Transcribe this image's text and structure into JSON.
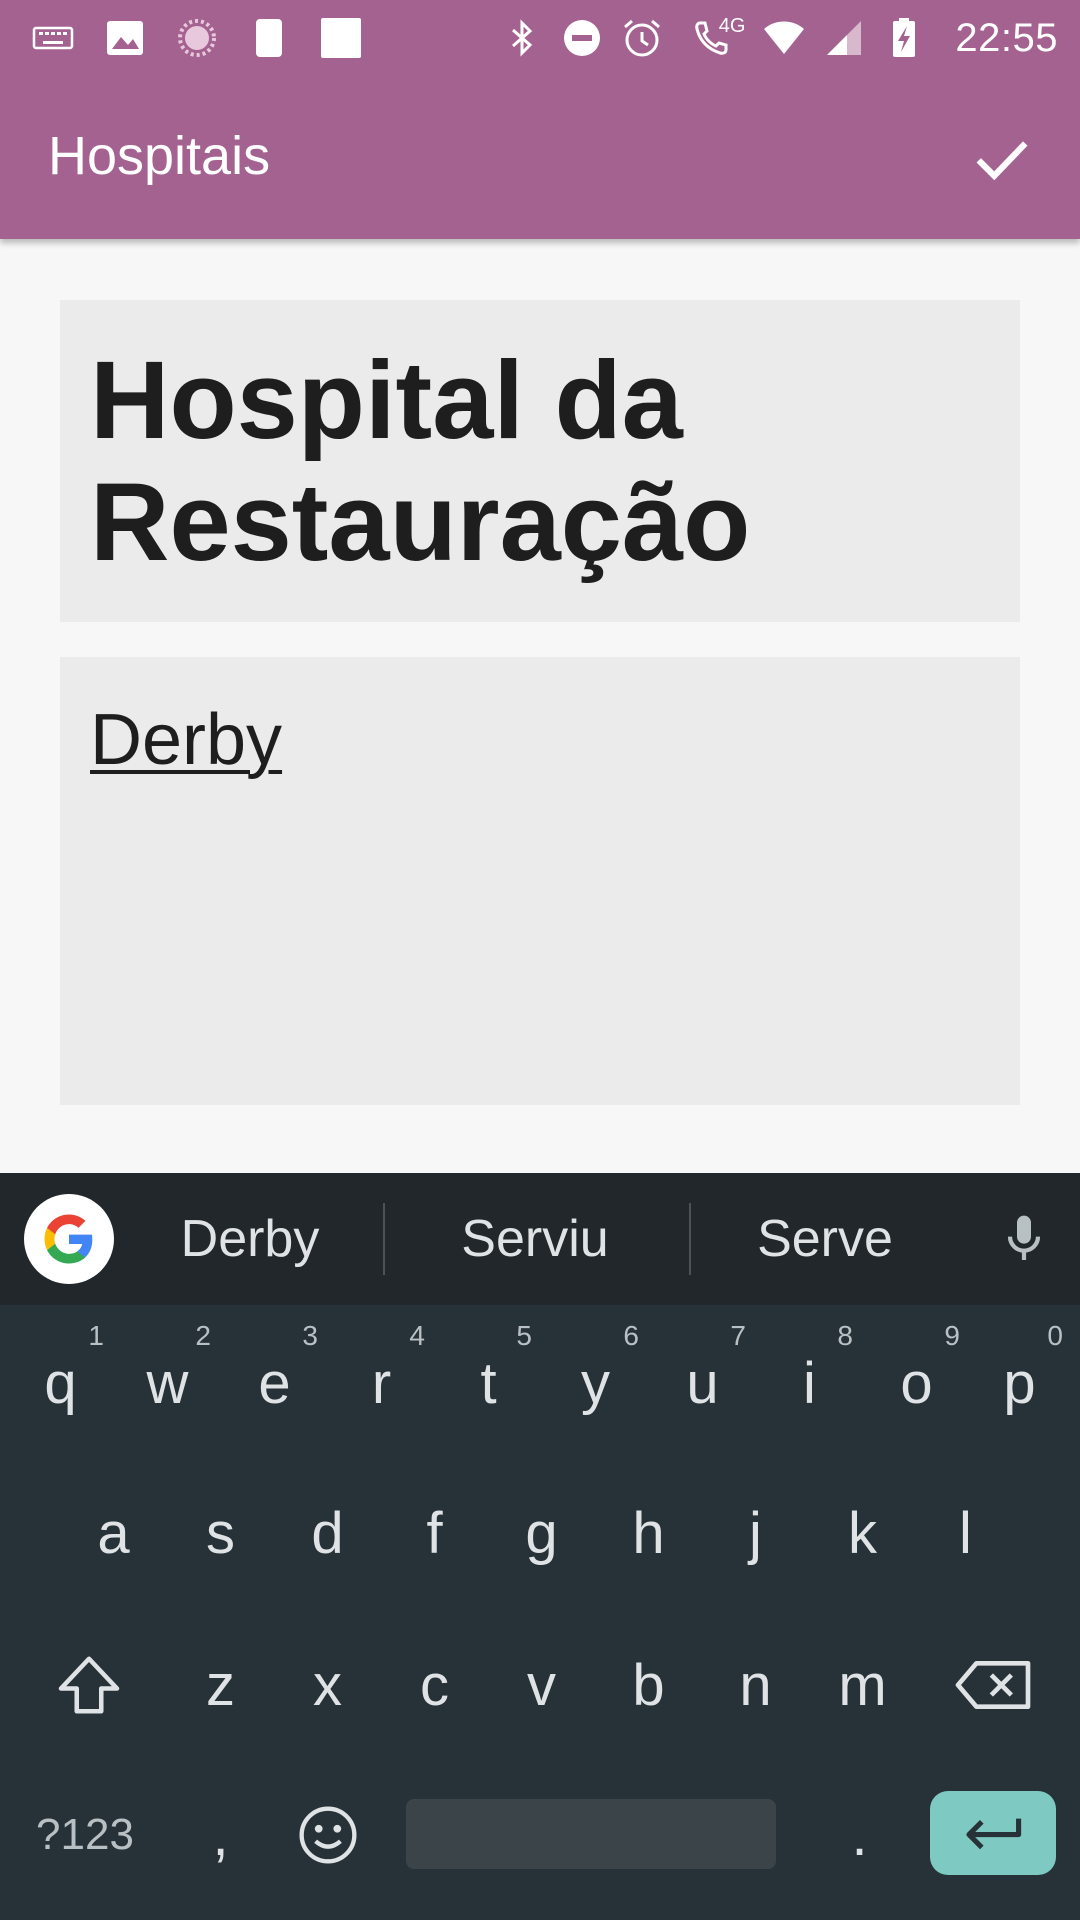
{
  "status_bar": {
    "time": "22:55",
    "network_label": "4G",
    "left_icons": [
      "keyboard-icon",
      "image-icon",
      "loading-icon",
      "moon-icon",
      "square-icon"
    ],
    "right_icons": [
      "bluetooth-icon",
      "do-not-disturb-icon",
      "alarm-icon",
      "wifi-calling-icon",
      "wifi-icon",
      "signal-icon",
      "battery-charging-icon"
    ]
  },
  "app_bar": {
    "title": "Hospitais",
    "action_icon": "check-icon",
    "color": "#a46290"
  },
  "form": {
    "title_value": "Hospital da Restauração",
    "body_value": "Derby"
  },
  "keyboard": {
    "suggestions": [
      "Derby",
      "Serviu",
      "Serve"
    ],
    "row1": [
      {
        "label": "q",
        "hint": "1"
      },
      {
        "label": "w",
        "hint": "2"
      },
      {
        "label": "e",
        "hint": "3"
      },
      {
        "label": "r",
        "hint": "4"
      },
      {
        "label": "t",
        "hint": "5"
      },
      {
        "label": "y",
        "hint": "6"
      },
      {
        "label": "u",
        "hint": "7"
      },
      {
        "label": "i",
        "hint": "8"
      },
      {
        "label": "o",
        "hint": "9"
      },
      {
        "label": "p",
        "hint": "0"
      }
    ],
    "row2": [
      "a",
      "s",
      "d",
      "f",
      "g",
      "h",
      "j",
      "k",
      "l"
    ],
    "row3": [
      "z",
      "x",
      "c",
      "v",
      "b",
      "n",
      "m"
    ],
    "symbols_label": "?123",
    "comma_label": ",",
    "period_label": ".",
    "enter_color": "#7ecac3"
  }
}
